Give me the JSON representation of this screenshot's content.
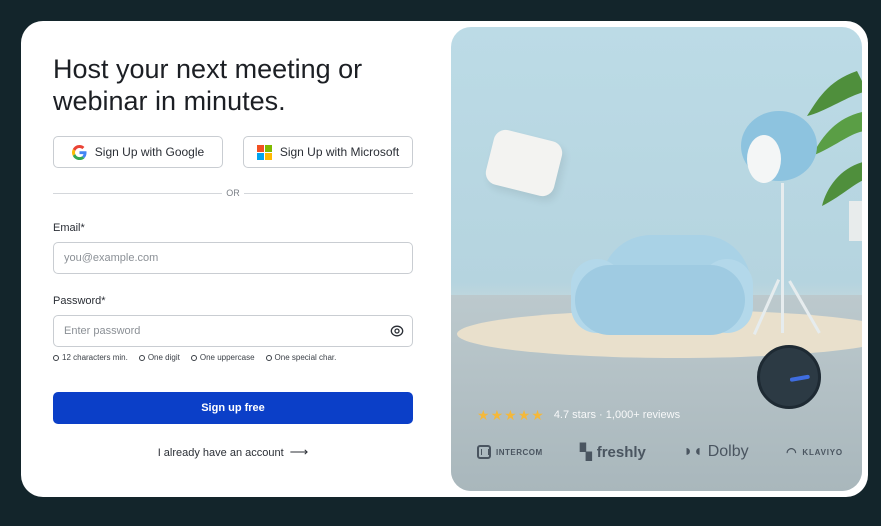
{
  "headline": "Host your next meeting or webinar in minutes.",
  "sso": {
    "google_label": "Sign Up with Google",
    "microsoft_label": "Sign Up with Microsoft"
  },
  "divider_text": "OR",
  "email": {
    "label": "Email*",
    "placeholder": "you@example.com",
    "value": ""
  },
  "password": {
    "label": "Password*",
    "placeholder": "Enter password",
    "value": ""
  },
  "requirements": [
    "12 characters min.",
    "One digit",
    "One uppercase",
    "One special char."
  ],
  "primary_button": "Sign up free",
  "login_link": "I already have an account",
  "rating": {
    "stars_value": 4.7,
    "stars_max": 5,
    "text": "4.7 stars · 1,000+ reviews"
  },
  "logos": {
    "intercom": "INTERCOM",
    "freshly": "freshly",
    "dolby": "Dolby",
    "klaviyo": "KLAVIYO"
  },
  "colors": {
    "primary": "#0b3fc8",
    "page_background": "#13252b",
    "star": "#f4b83a"
  }
}
